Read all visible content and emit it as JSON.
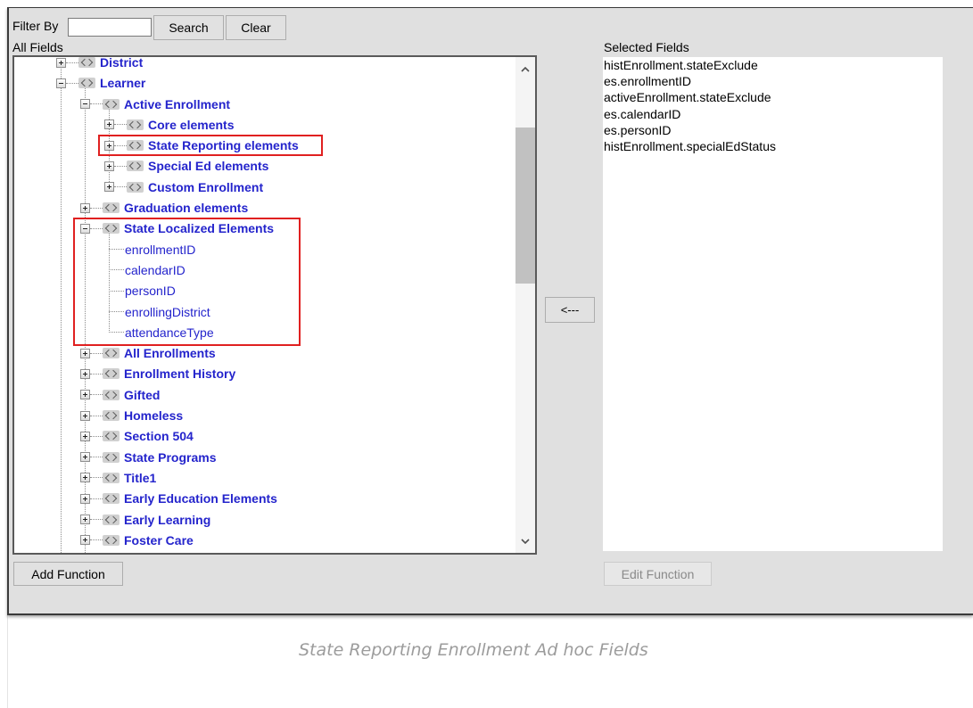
{
  "colors": {
    "link": "#2424cc",
    "highlight": "#e02020"
  },
  "icons": {
    "tree_node": "element-icon",
    "expand": "expand-icon",
    "collapse": "collapse-icon",
    "scroll_up": "scroll-up-icon",
    "scroll_down": "scroll-down-icon"
  },
  "filter": {
    "label": "Filter By",
    "value": "",
    "search_label": "Search",
    "clear_label": "Clear"
  },
  "all_fields": {
    "label": "All Fields",
    "tree": [
      {
        "label": "District",
        "expanded": false
      },
      {
        "label": "Learner",
        "expanded": true,
        "children": [
          {
            "label": "Active Enrollment",
            "expanded": true,
            "children": [
              {
                "label": "Core elements",
                "expanded": false
              },
              {
                "label": "State Reporting elements",
                "expanded": false,
                "highlighted": true
              },
              {
                "label": "Special Ed elements",
                "expanded": false
              },
              {
                "label": "Custom Enrollment",
                "expanded": false
              }
            ]
          },
          {
            "label": "Graduation elements",
            "expanded": false
          },
          {
            "label": "State Localized Elements",
            "expanded": true,
            "highlighted": true,
            "children": [
              {
                "label": "enrollmentID"
              },
              {
                "label": "calendarID"
              },
              {
                "label": "personID"
              },
              {
                "label": "enrollingDistrict"
              },
              {
                "label": "attendanceType"
              }
            ]
          },
          {
            "label": "All Enrollments",
            "expanded": false
          },
          {
            "label": "Enrollment History",
            "expanded": false
          },
          {
            "label": "Gifted",
            "expanded": false
          },
          {
            "label": "Homeless",
            "expanded": false
          },
          {
            "label": "Section 504",
            "expanded": false
          },
          {
            "label": "State Programs",
            "expanded": false
          },
          {
            "label": "Title1",
            "expanded": false
          },
          {
            "label": "Early Education Elements",
            "expanded": false
          },
          {
            "label": "Early Learning",
            "expanded": false
          },
          {
            "label": "Foster Care",
            "expanded": false
          }
        ]
      }
    ],
    "scroll": {
      "position": 0.18,
      "visible_fraction": 0.335
    }
  },
  "move_left_label": "<---",
  "selected_fields": {
    "label": "Selected Fields",
    "items": [
      "histEnrollment.stateExclude",
      "es.enrollmentID",
      "activeEnrollment.stateExclude",
      "es.calendarID",
      "es.personID",
      "histEnrollment.specialEdStatus"
    ]
  },
  "add_function_label": "Add Function",
  "edit_function_label": "Edit Function",
  "edit_function_disabled": true,
  "caption": "State Reporting Enrollment Ad hoc Fields"
}
